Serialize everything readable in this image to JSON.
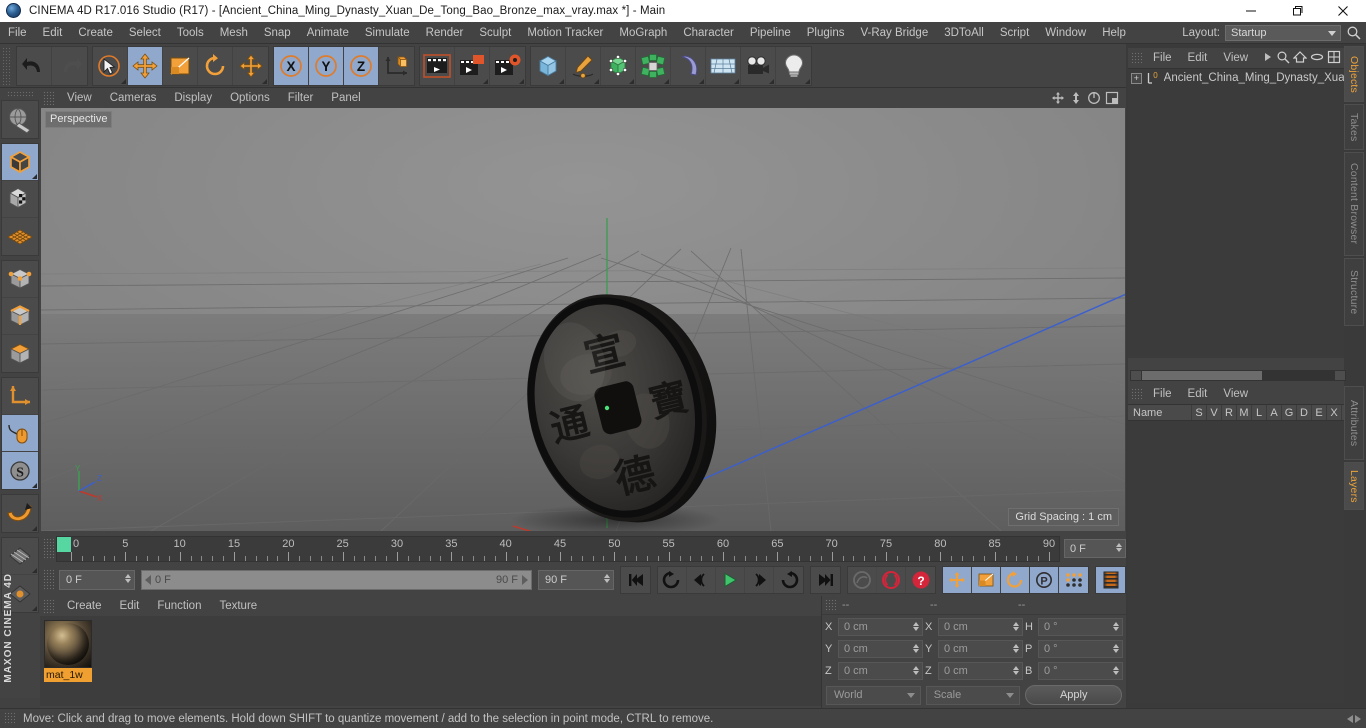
{
  "window": {
    "title": "CINEMA 4D R17.016 Studio (R17) - [Ancient_China_Ming_Dynasty_Xuan_De_Tong_Bao_Bronze_max_vray.max *] - Main",
    "app_icon": "c4d-globe-icon",
    "controls": {
      "minimize": "minimize-icon",
      "maximize": "maximize-icon",
      "close": "close-icon"
    }
  },
  "menubar": {
    "items": [
      "File",
      "Edit",
      "Create",
      "Select",
      "Tools",
      "Mesh",
      "Snap",
      "Animate",
      "Simulate",
      "Render",
      "Sculpt",
      "Motion Tracker",
      "MoGraph",
      "Character",
      "Pipeline",
      "Plugins",
      "V-Ray Bridge",
      "3DToAll",
      "Script",
      "Window",
      "Help"
    ],
    "layout_label": "Layout:",
    "layout_value": "Startup",
    "search_icon": "search-icon"
  },
  "toolbar": {
    "groups": [
      {
        "name": "history",
        "buttons": [
          {
            "icon": "undo-icon",
            "active": false,
            "disabled": false
          },
          {
            "icon": "redo-icon",
            "active": false,
            "disabled": true
          }
        ]
      },
      {
        "name": "transform-tools",
        "buttons": [
          {
            "icon": "live-selection-icon",
            "active": false,
            "disabled": false,
            "corner": true
          },
          {
            "icon": "move-tool-icon",
            "active": true,
            "disabled": false
          },
          {
            "icon": "scale-tool-icon",
            "active": false,
            "disabled": false
          },
          {
            "icon": "rotate-tool-icon",
            "active": false,
            "disabled": false
          },
          {
            "icon": "move-alt-icon",
            "active": false,
            "disabled": false,
            "corner": true
          }
        ]
      },
      {
        "name": "axis-locks",
        "buttons": [
          {
            "icon": "axis-x-icon",
            "active": true,
            "disabled": false
          },
          {
            "icon": "axis-y-icon",
            "active": true,
            "disabled": false
          },
          {
            "icon": "axis-z-icon",
            "active": true,
            "disabled": false
          },
          {
            "icon": "world-coordinate-icon",
            "active": false,
            "disabled": false
          }
        ]
      },
      {
        "name": "render",
        "buttons": [
          {
            "icon": "render-view-icon",
            "active": false,
            "disabled": false
          },
          {
            "icon": "render-region-icon",
            "active": false,
            "disabled": false,
            "corner": true
          },
          {
            "icon": "render-settings-icon",
            "active": false,
            "disabled": false,
            "corner": true
          }
        ]
      },
      {
        "name": "create-objects",
        "buttons": [
          {
            "icon": "cube-primitive-icon",
            "active": false,
            "disabled": false,
            "corner": true
          },
          {
            "icon": "spline-pen-icon",
            "active": false,
            "disabled": false,
            "corner": true
          },
          {
            "icon": "generator-nurbs-icon",
            "active": false,
            "disabled": false,
            "corner": true
          },
          {
            "icon": "mograph-cloner-icon",
            "active": false,
            "disabled": false,
            "corner": true
          },
          {
            "icon": "deformer-bend-icon",
            "active": false,
            "disabled": false,
            "corner": true
          },
          {
            "icon": "environment-floor-icon",
            "active": false,
            "disabled": false,
            "corner": true
          },
          {
            "icon": "camera-icon",
            "active": false,
            "disabled": false,
            "corner": true
          },
          {
            "icon": "light-icon",
            "active": false,
            "disabled": false,
            "corner": true
          }
        ]
      }
    ]
  },
  "left_toolbar": {
    "buttons": [
      {
        "icon": "make-editable-icon",
        "active": false
      },
      {
        "icon": "model-mode-icon",
        "active": true,
        "corner": true
      },
      {
        "icon": "texture-mode-icon",
        "active": false
      },
      {
        "icon": "workplane-mode-icon",
        "active": false
      },
      {
        "icon": "point-mode-icon",
        "active": false
      },
      {
        "icon": "edge-mode-icon",
        "active": false
      },
      {
        "icon": "polygon-mode-icon",
        "active": false
      },
      {
        "icon": "object-axis-mode-icon",
        "active": false
      },
      {
        "icon": "enable-snap-icon",
        "active": true
      },
      {
        "icon": "snap-settings-icon",
        "active": true,
        "corner": true
      },
      {
        "icon": "workplane-lock-icon",
        "active": false,
        "corner": true
      },
      {
        "icon": "viewport-solo-icon",
        "active": false
      },
      {
        "icon": "viewport-filter-icon",
        "active": false
      }
    ],
    "brand": "MAXON CINEMA 4D"
  },
  "viewport": {
    "menu": [
      "View",
      "Cameras",
      "Display",
      "Options",
      "Filter",
      "Panel"
    ],
    "nav_icons": [
      "pan-icon",
      "dolly-icon",
      "orbit-icon",
      "maximize-viewport-icon"
    ],
    "label": "Perspective",
    "grid_spacing": "Grid Spacing : 1 cm",
    "axis_gizmo": {
      "x": "X",
      "y": "Y",
      "z": "Z"
    },
    "scene_object": "ancient-chinese-coin"
  },
  "timeline": {
    "ticks": [
      0,
      5,
      10,
      15,
      20,
      25,
      30,
      35,
      40,
      45,
      50,
      55,
      60,
      65,
      70,
      75,
      80,
      85,
      90
    ],
    "start": 0,
    "end": 90,
    "current_frame": "0 F",
    "playhead_frame": "0 F"
  },
  "transport": {
    "current_frame_field": "0 F",
    "range_start": "0 F",
    "range_end": "90 F",
    "end_frame_field": "90 F",
    "buttons": [
      {
        "icon": "go-to-start-icon",
        "active": false,
        "disabled": false
      },
      {
        "icon": "previous-key-icon",
        "active": false,
        "disabled": false
      },
      {
        "icon": "step-back-icon",
        "active": false,
        "disabled": false
      },
      {
        "icon": "play-icon",
        "active": false,
        "disabled": false
      },
      {
        "icon": "step-forward-icon",
        "active": false,
        "disabled": false
      },
      {
        "icon": "next-key-icon",
        "active": false,
        "disabled": false
      },
      {
        "icon": "go-to-end-icon",
        "active": false,
        "disabled": false
      },
      {
        "icon": "record-active-objects-icon",
        "active": false,
        "disabled": true
      },
      {
        "icon": "autokeying-icon",
        "active": false,
        "disabled": false
      },
      {
        "icon": "keyframe-selection-icon",
        "active": false,
        "disabled": false
      },
      {
        "icon": "key-position-icon",
        "active": true,
        "disabled": false
      },
      {
        "icon": "key-scale-icon",
        "active": true,
        "disabled": false
      },
      {
        "icon": "key-rotation-icon",
        "active": true,
        "disabled": false
      },
      {
        "icon": "key-parameter-icon",
        "active": true,
        "disabled": false
      },
      {
        "icon": "key-pla-icon",
        "active": true,
        "disabled": false
      },
      {
        "icon": "timeline-filmstrip-icon",
        "active": true,
        "disabled": false
      }
    ]
  },
  "material_manager": {
    "menu": [
      "Create",
      "Edit",
      "Function",
      "Texture"
    ],
    "materials": [
      {
        "name": "mat_1w",
        "preview": "bronze-sphere-preview"
      }
    ]
  },
  "coordinates": {
    "headers": [
      "--",
      "--",
      "--"
    ],
    "rows": [
      {
        "pos_label": "X",
        "pos_value": "0 cm",
        "size_label": "X",
        "size_value": "0 cm",
        "rot_label": "H",
        "rot_value": "0 °"
      },
      {
        "pos_label": "Y",
        "pos_value": "0 cm",
        "size_label": "Y",
        "size_value": "0 cm",
        "rot_label": "P",
        "rot_value": "0 °"
      },
      {
        "pos_label": "Z",
        "pos_value": "0 cm",
        "size_label": "Z",
        "size_value": "0 cm",
        "rot_label": "B",
        "rot_value": "0 °"
      }
    ],
    "coord_system": "World",
    "transform_mode": "Scale",
    "apply_label": "Apply"
  },
  "object_manager": {
    "menu": [
      "File",
      "Edit",
      "View"
    ],
    "icons": [
      "more-arrow-icon",
      "search-icon",
      "home-icon",
      "ellipse-icon",
      "fit-icon"
    ],
    "objects": [
      {
        "name": "Ancient_China_Ming_Dynasty_Xuan",
        "tag": "0"
      }
    ]
  },
  "attributes_panel": {
    "menu": [
      "File",
      "Edit",
      "View"
    ],
    "columns": [
      "Name",
      "S",
      "V",
      "R",
      "M",
      "L",
      "A",
      "G",
      "D",
      "E",
      "X"
    ]
  },
  "vertical_tabs": [
    {
      "label": "Objects",
      "selected": true
    },
    {
      "label": "Takes",
      "selected": false
    },
    {
      "label": "Content Browser",
      "selected": false
    },
    {
      "label": "Structure",
      "selected": false
    },
    {
      "label": "Attributes",
      "selected": false
    },
    {
      "label": "Layers",
      "selected": true
    }
  ],
  "statusbar": {
    "message": "Move: Click and drag to move elements. Hold down SHIFT to quantize movement / add to the selection in point mode, CTRL to remove."
  },
  "colors": {
    "accent_orange": "#f0a030",
    "active_blue": "#8fa8cb",
    "panel_bg": "#434343",
    "field_bg": "#4b4b4b",
    "play_green": "#3fc46b",
    "axis_x_red": "#c0392b",
    "axis_y_green": "#3faa55",
    "axis_z_blue": "#3a5fd0"
  }
}
